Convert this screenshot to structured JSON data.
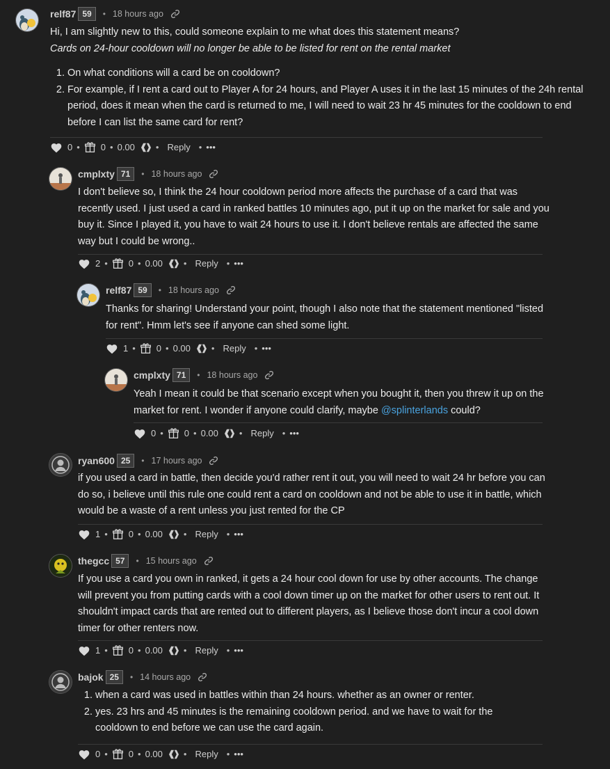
{
  "comments": [
    {
      "author": "relf87",
      "rep": "59",
      "time": "18 hours ago",
      "avatar": "bear-character",
      "text": "Hi, I am slightly new to this, could someone explain to me what does this statement means?",
      "quote": "Cards on 24-hour cooldown will no longer be able to be listed for rent on the rental market",
      "list": [
        "On what conditions will a card be on cooldown?",
        "For example, if I rent a card out to Player A for 24 hours, and Player A uses it in the last 15 minutes of the 24h rental period, does it mean when the card is returned to me, I will need to wait 23 hr 45 minutes for the cooldown to end before I can list the same card for rent?"
      ],
      "likes": "0",
      "gifts": "0",
      "amount": "0.00",
      "reply_label": "Reply"
    },
    {
      "author": "cmplxty",
      "rep": "71",
      "time": "18 hours ago",
      "avatar": "figure-photo",
      "text": "I don't believe so, I think the 24 hour cooldown period more affects the purchase of a card that was recently used. I just used a card in ranked battles 10 minutes ago, put it up on the market for sale and you buy it. Since I played it, you have to wait 24 hours to use it. I don't believe rentals are affected the same way but I could be wrong..",
      "likes": "2",
      "gifts": "0",
      "amount": "0.00",
      "reply_label": "Reply"
    },
    {
      "author": "relf87",
      "rep": "59",
      "time": "18 hours ago",
      "avatar": "bear-character",
      "text": "Thanks for sharing! Understand your point, though I also note that the statement mentioned \"listed for rent\". Hmm let's see if anyone can shed some light.",
      "likes": "1",
      "gifts": "0",
      "amount": "0.00",
      "reply_label": "Reply"
    },
    {
      "author": "cmplxty",
      "rep": "71",
      "time": "18 hours ago",
      "avatar": "figure-photo",
      "text_before": "Yeah I mean it could be that scenario except when you bought it, then you threw it up on the market for rent. I wonder if anyone could clarify, maybe ",
      "mention": "@splinterlands",
      "text_after": " could?",
      "likes": "0",
      "gifts": "0",
      "amount": "0.00",
      "reply_label": "Reply"
    },
    {
      "author": "ryan600",
      "rep": "25",
      "time": "17 hours ago",
      "avatar": "default-user",
      "text": "if you used a card in battle, then decide you'd rather rent it out, you will need to wait 24 hr before you can do so, i believe until this rule one could rent a card on cooldown and not be able to use it in battle, which would be a waste of a rent unless you just rented for the CP",
      "likes": "1",
      "gifts": "0",
      "amount": "0.00",
      "reply_label": "Reply"
    },
    {
      "author": "thegcc",
      "rep": "57",
      "time": "15 hours ago",
      "avatar": "yellow-character",
      "text": "If you use a card you own in ranked, it gets a 24 hour cool down for use by other accounts. The change will prevent you from putting cards with a cool down timer up on the market for other users to rent out. It shouldn't impact cards that are rented out to different players, as I believe those don't incur a cool down timer for other renters now.",
      "likes": "1",
      "gifts": "0",
      "amount": "0.00",
      "reply_label": "Reply"
    },
    {
      "author": "bajok",
      "rep": "25",
      "time": "14 hours ago",
      "avatar": "default-user",
      "list": [
        "when a card was used in battles within than 24 hours. whether as an owner or renter.",
        "yes. 23 hrs and 45 minutes is the remaining cooldown period. and we have to wait for the cooldown to end before we can use the card again."
      ],
      "likes": "0",
      "gifts": "0",
      "amount": "0.00",
      "reply_label": "Reply"
    }
  ]
}
